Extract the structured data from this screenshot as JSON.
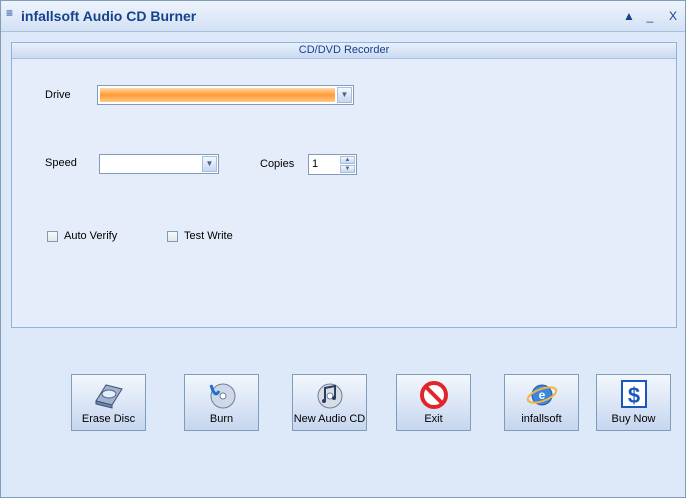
{
  "window": {
    "title": "infallsoft Audio CD Burner"
  },
  "titlebar": {
    "sys_icon": "menu-lines-icon",
    "min_glyph": "▲",
    "restore_glyph": "_",
    "close_glyph": "X"
  },
  "group": {
    "title": "CD/DVD Recorder"
  },
  "form": {
    "drive_label": "Drive",
    "speed_label": "Speed",
    "copies_label": "Copies",
    "copies_value": "1",
    "auto_verify_label": "Auto Verify",
    "test_write_label": "Test Write"
  },
  "buttons": [
    {
      "label": "Erase Disc",
      "icon": "erase-disc-icon"
    },
    {
      "label": "Burn",
      "icon": "burn-cd-icon"
    },
    {
      "label": "New Audio CD",
      "icon": "new-audio-cd-icon"
    },
    {
      "label": "Exit",
      "icon": "exit-icon"
    },
    {
      "label": "infallsoft",
      "icon": "infallsoft-icon"
    },
    {
      "label": "Buy Now",
      "icon": "dollar-icon"
    }
  ],
  "colors": {
    "accent": "#15428b",
    "drive_fill": "#ff9c35",
    "exit_red": "#e0262b",
    "dollar_blue": "#1b55c0"
  }
}
